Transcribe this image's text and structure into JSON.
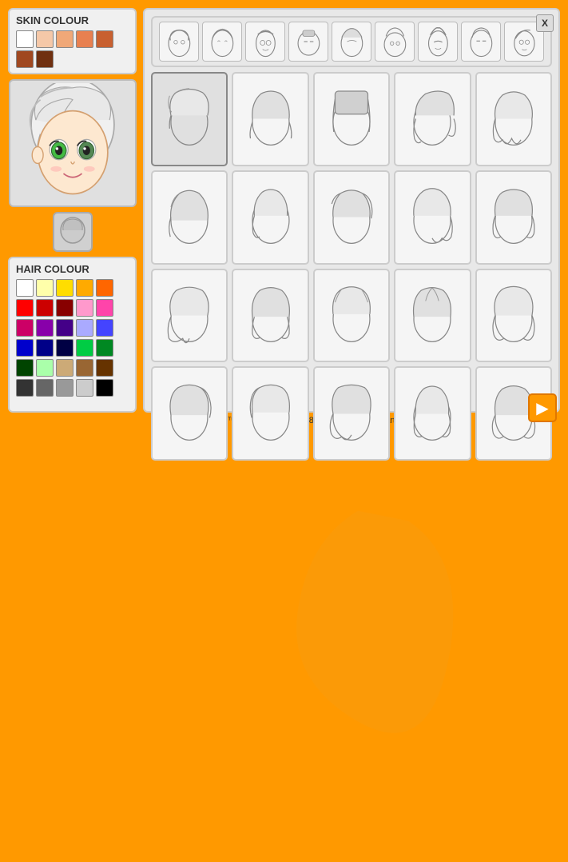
{
  "app": {
    "title": "Anime Face Maker™ version 1.0 © geN8Hedgehog.deviantart.com",
    "background_color": "#ff9900"
  },
  "skin_colour": {
    "label": "SKIN COLOUR",
    "swatches": [
      "#ffffff",
      "#f5c8a8",
      "#f0a878",
      "#e88050",
      "#c86030",
      "#a04820",
      "#703010"
    ]
  },
  "hair_colour": {
    "label": "HAIR COLOUR",
    "swatches": [
      "#ffffff",
      "#ffffaa",
      "#ffdd00",
      "#ffaa00",
      "#ff6600",
      "#ff0000",
      "#cc0000",
      "#880000",
      "#ff99cc",
      "#ff44aa",
      "#cc0066",
      "#8800aa",
      "#440088",
      "#aaaaff",
      "#4444ff",
      "#0000cc",
      "#000088",
      "#000044",
      "#00cc44",
      "#008822",
      "#004400",
      "#aaffaa",
      "#ccaa77",
      "#996633",
      "#663300",
      "#333333",
      "#666666",
      "#999999",
      "#cccccc",
      "#000000"
    ]
  },
  "close_button": "X",
  "nav_arrow": "▶",
  "hair_styles_count": 20,
  "face_styles_count": 9,
  "selected_hair": 0,
  "selected_face": 0
}
